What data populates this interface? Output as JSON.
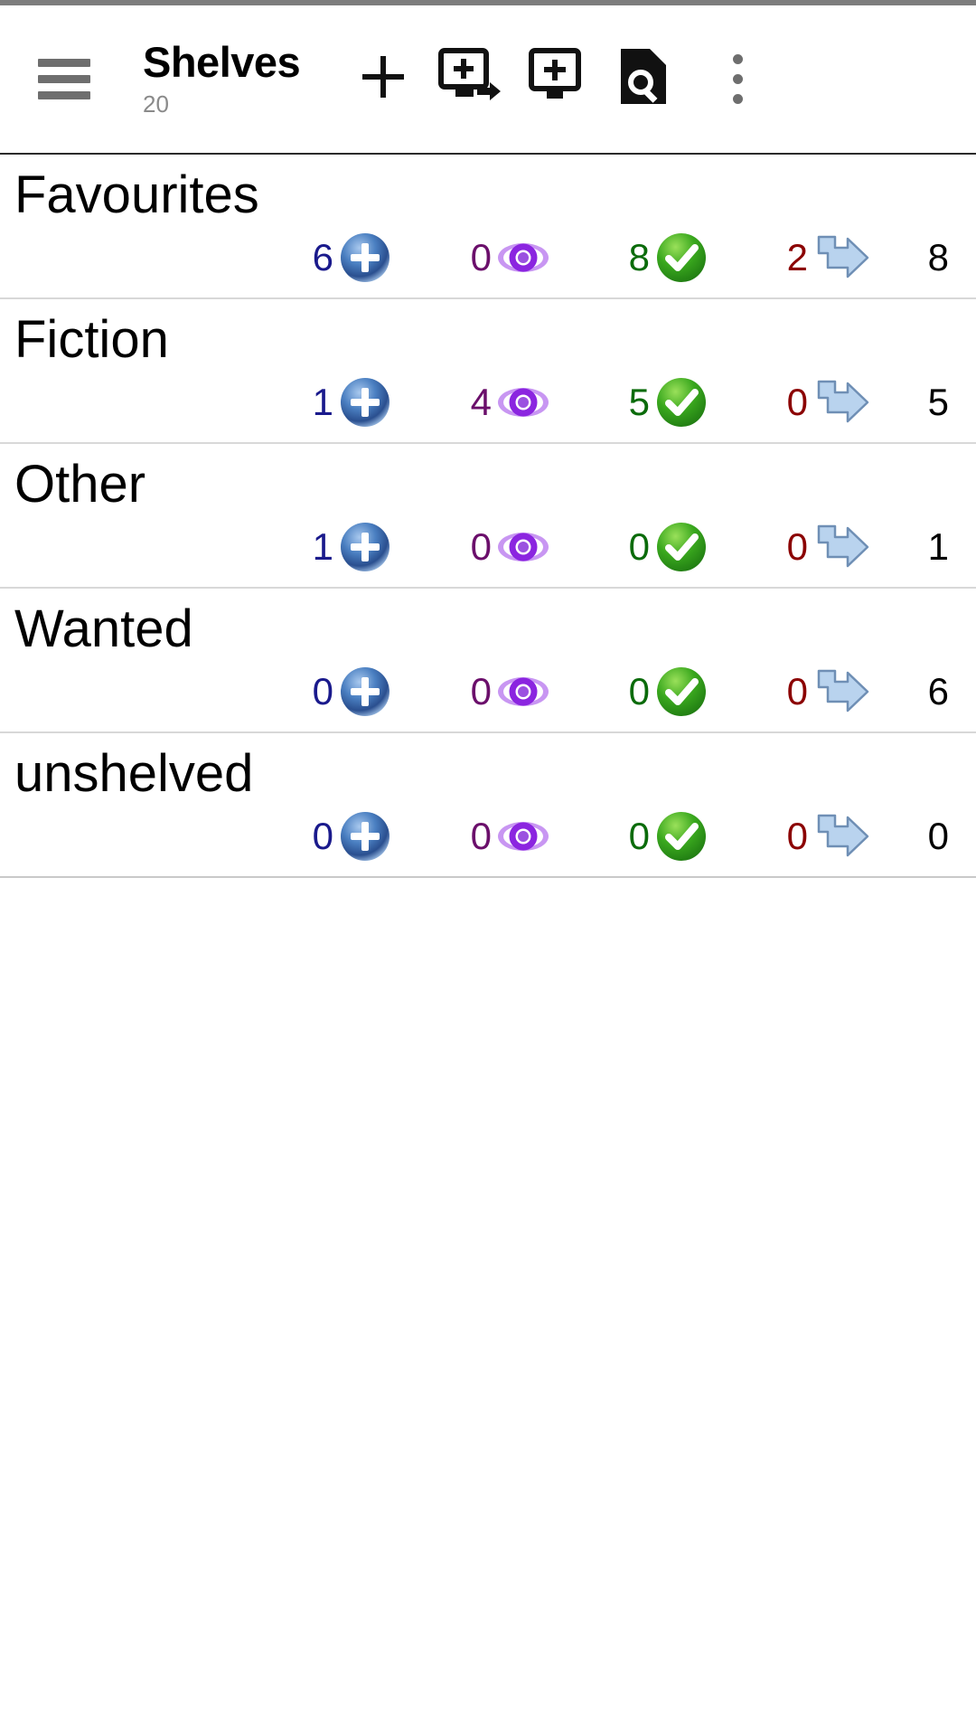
{
  "app": {
    "title": "Shelves",
    "subtitle": "20"
  },
  "header": {
    "menu_icon": "hamburger-menu-icon",
    "actions": [
      {
        "name": "add-shelf-button",
        "icon": "plus-icon",
        "label": "+"
      },
      {
        "name": "add-book-by-scan-button",
        "icon": "monitor-plus-arrow-icon",
        "label": ""
      },
      {
        "name": "add-book-button",
        "icon": "monitor-plus-icon",
        "label": ""
      },
      {
        "name": "search-button",
        "icon": "document-search-icon",
        "label": ""
      },
      {
        "name": "overflow-menu-button",
        "icon": "more-vertical-icon",
        "label": ""
      }
    ]
  },
  "columns": [
    {
      "key": "to_read",
      "icon": "blue-plus-circle-icon",
      "color": "#1a1a8c"
    },
    {
      "key": "reading",
      "icon": "purple-eye-icon",
      "color": "#6b0f6b"
    },
    {
      "key": "read",
      "icon": "green-check-circle-icon",
      "color": "#0a6b0a"
    },
    {
      "key": "lent",
      "icon": "blue-arrow-icon",
      "color": "#8b0000"
    },
    {
      "key": "total",
      "icon": "",
      "color": "#000000"
    }
  ],
  "shelves": [
    {
      "name": "Favourites",
      "to_read": "6",
      "reading": "0",
      "read": "8",
      "lent": "2",
      "total": "8"
    },
    {
      "name": "Fiction",
      "to_read": "1",
      "reading": "4",
      "read": "5",
      "lent": "0",
      "total": "5"
    },
    {
      "name": "Other",
      "to_read": "1",
      "reading": "0",
      "read": "0",
      "lent": "0",
      "total": "1"
    },
    {
      "name": "Wanted",
      "to_read": "0",
      "reading": "0",
      "read": "0",
      "lent": "0",
      "total": "6"
    },
    {
      "name": "unshelved",
      "to_read": "0",
      "reading": "0",
      "read": "0",
      "lent": "0",
      "total": "0"
    }
  ],
  "colors": {
    "status_bar": "#7d7d7d",
    "divider": "#d8d8d8",
    "appbar_border": "#2b2b2b",
    "subtitle": "#8a8a8a",
    "icon_grey": "#6e6e6e"
  }
}
